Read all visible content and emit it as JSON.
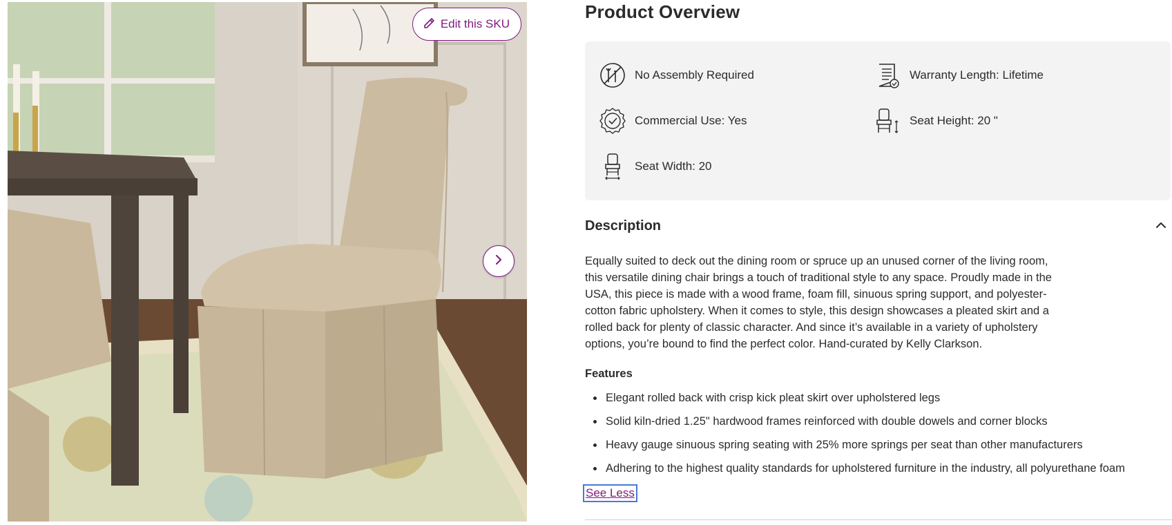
{
  "gallery": {
    "edit_button_label": "Edit this SKU",
    "next_arrow_icon": "chevron-right-icon",
    "accent_color": "#7f187f"
  },
  "overview": {
    "title": "Product Overview",
    "specs": [
      {
        "icon": "no-tools-icon",
        "label": "No Assembly Required"
      },
      {
        "icon": "warranty-document-icon",
        "label": "Warranty Length: Lifetime"
      },
      {
        "icon": "badge-check-icon",
        "label": "Commercial Use: Yes"
      },
      {
        "icon": "seat-height-icon",
        "label": "Seat Height: 20 \""
      },
      {
        "icon": "seat-width-icon",
        "label": "Seat Width: 20"
      }
    ]
  },
  "description": {
    "heading": "Description",
    "collapse_icon": "chevron-up-icon",
    "body": "Equally suited to deck out the dining room or spruce up an unused corner of the living room, this versatile dining chair brings a touch of traditional style to any space. Proudly made in the USA, this piece is made with a wood frame, foam fill, sinuous spring support, and polyester-cotton fabric upholstery. When it comes to style, this design showcases a pleated skirt and a rolled back for plenty of classic character. And since it’s available in a variety of upholstery options, you’re bound to find the perfect color. Hand-curated by Kelly Clarkson.",
    "features_heading": "Features",
    "features": [
      "Elegant rolled back with crisp kick pleat skirt over upholstered legs",
      "Solid kiln-dried 1.25\" hardwood frames reinforced with double dowels and corner blocks",
      "Heavy gauge sinuous spring seating with 25% more springs per seat than other manufacturers",
      "Adhering to the highest quality standards for upholstered furniture in the industry, all polyurethane foam"
    ],
    "see_less_label": "See Less"
  }
}
